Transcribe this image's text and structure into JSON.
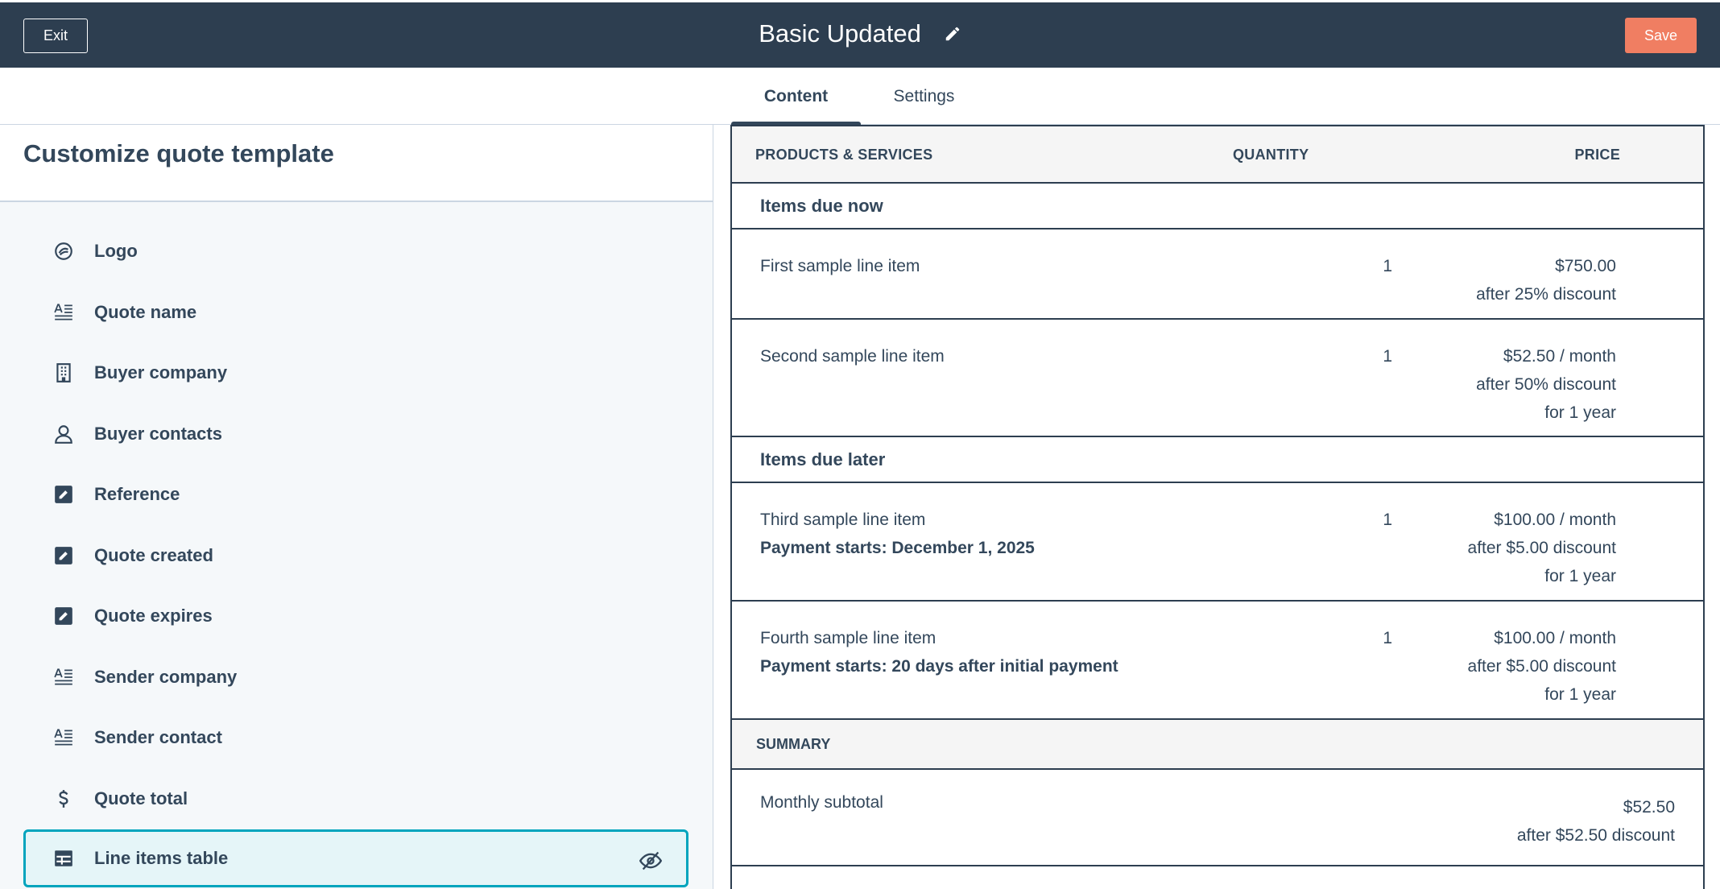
{
  "header": {
    "exit_label": "Exit",
    "title": "Basic Updated",
    "save_label": "Save"
  },
  "tabs": [
    {
      "label": "Content",
      "active": true
    },
    {
      "label": "Settings",
      "active": false
    }
  ],
  "left_panel": {
    "title": "Customize quote template",
    "modules": [
      {
        "label": "Logo",
        "icon": "logo-icon"
      },
      {
        "label": "Quote name",
        "icon": "text-icon"
      },
      {
        "label": "Buyer company",
        "icon": "building-icon"
      },
      {
        "label": "Buyer contacts",
        "icon": "person-icon"
      },
      {
        "label": "Reference",
        "icon": "edit-icon"
      },
      {
        "label": "Quote created",
        "icon": "edit-icon"
      },
      {
        "label": "Quote expires",
        "icon": "edit-icon"
      },
      {
        "label": "Sender company",
        "icon": "text-icon"
      },
      {
        "label": "Sender contact",
        "icon": "text-icon"
      },
      {
        "label": "Quote total",
        "icon": "dollar-icon"
      },
      {
        "label": "Line items table",
        "icon": "table-icon",
        "selected": true,
        "visibility_icon": "eye-slash-icon"
      }
    ]
  },
  "table": {
    "headers": {
      "product": "PRODUCTS & SERVICES",
      "quantity": "QUANTITY",
      "price": "PRICE"
    },
    "group_now": "Items due now",
    "group_later": "Items due later",
    "items": [
      {
        "name": "First sample line item",
        "payment": "",
        "qty": "1",
        "price_lines": [
          "$750.00",
          "after 25% discount"
        ]
      },
      {
        "name": "Second sample line item",
        "payment": "",
        "qty": "1",
        "price_lines": [
          "$52.50 / month",
          "after 50% discount",
          "for 1 year"
        ]
      },
      {
        "name": "Third sample line item",
        "payment": "Payment starts: December 1, 2025",
        "qty": "1",
        "price_lines": [
          "$100.00 / month",
          "after $5.00 discount",
          "for 1 year"
        ]
      },
      {
        "name": "Fourth sample line item",
        "payment": "Payment starts: 20 days after initial payment",
        "qty": "1",
        "price_lines": [
          "$100.00 / month",
          "after $5.00 discount",
          "for 1 year"
        ]
      }
    ],
    "summary_label": "SUMMARY",
    "subtotal": {
      "label": "Monthly subtotal",
      "price_lines": [
        "$52.50",
        "after $52.50 discount"
      ]
    }
  },
  "colors": {
    "header_bg": "#2d3e50",
    "save_bg": "#f07e62",
    "selected_border": "#00a4bd",
    "text": "#33475b"
  }
}
